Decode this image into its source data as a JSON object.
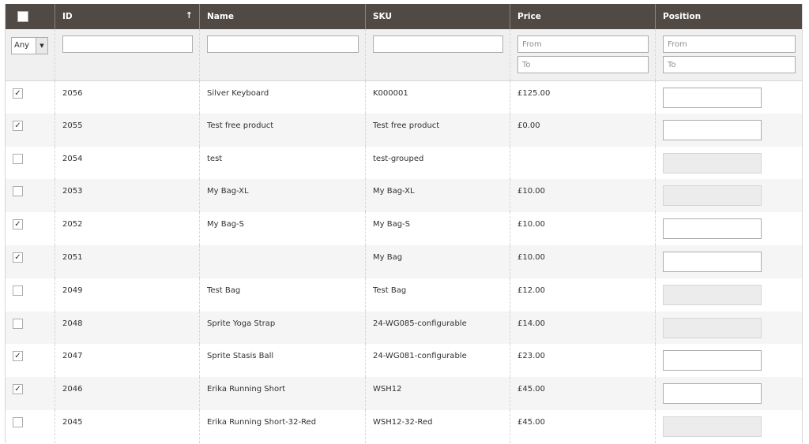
{
  "columns": {
    "id": "ID",
    "name": "Name",
    "sku": "SKU",
    "price": "Price",
    "position": "Position"
  },
  "filters": {
    "in_products_value": "Any",
    "price_from_placeholder": "From",
    "price_to_placeholder": "To",
    "position_from_placeholder": "From",
    "position_to_placeholder": "To"
  },
  "sort": {
    "column": "ID",
    "indicator": "↑"
  },
  "rows": [
    {
      "checked": true,
      "id": "2056",
      "name": "Silver Keyboard",
      "sku": "K000001",
      "price": "£125.00",
      "position_enabled": true
    },
    {
      "checked": true,
      "id": "2055",
      "name": "Test free product",
      "sku": "Test free product",
      "price": "£0.00",
      "position_enabled": true
    },
    {
      "checked": false,
      "id": "2054",
      "name": "test",
      "sku": "test-grouped",
      "price": "",
      "position_enabled": false
    },
    {
      "checked": false,
      "id": "2053",
      "name": "My Bag-XL",
      "sku": "My Bag-XL",
      "price": "£10.00",
      "position_enabled": false
    },
    {
      "checked": true,
      "id": "2052",
      "name": "My Bag-S",
      "sku": "My Bag-S",
      "price": "£10.00",
      "position_enabled": true
    },
    {
      "checked": true,
      "id": "2051",
      "name": "",
      "sku": "My Bag",
      "price": "£10.00",
      "position_enabled": true
    },
    {
      "checked": false,
      "id": "2049",
      "name": "Test Bag",
      "sku": "Test Bag",
      "price": "£12.00",
      "position_enabled": false
    },
    {
      "checked": false,
      "id": "2048",
      "name": "Sprite Yoga Strap",
      "sku": "24-WG085-configurable",
      "price": "£14.00",
      "position_enabled": false
    },
    {
      "checked": true,
      "id": "2047",
      "name": "Sprite Stasis Ball",
      "sku": "24-WG081-configurable",
      "price": "£23.00",
      "position_enabled": true
    },
    {
      "checked": true,
      "id": "2046",
      "name": "Erika Running Short",
      "sku": "WSH12",
      "price": "£45.00",
      "position_enabled": true
    },
    {
      "checked": false,
      "id": "2045",
      "name": "Erika Running Short-32-Red",
      "sku": "WSH12-32-Red",
      "price": "£45.00",
      "position_enabled": false
    }
  ],
  "icons": {
    "check": "checkmark-icon",
    "sort": "sort-ascending-icon",
    "dropdown": "chevron-down-icon"
  },
  "colors": {
    "header_bg": "#514943",
    "filter_bg": "#f0f0f0",
    "row_alt_bg": "#f5f5f5"
  }
}
